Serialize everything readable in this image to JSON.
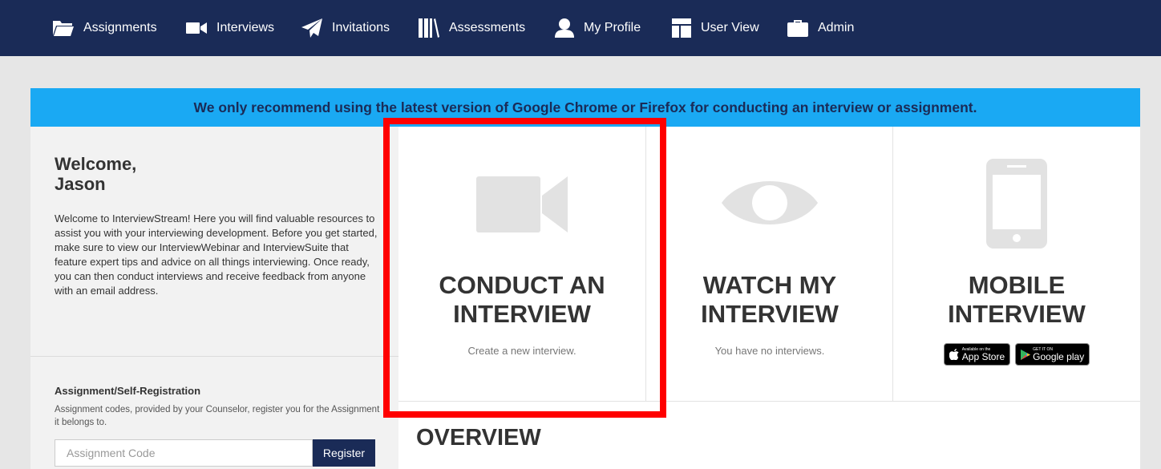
{
  "nav": {
    "assignments": "Assignments",
    "interviews": "Interviews",
    "invitations": "Invitations",
    "assessments": "Assessments",
    "profile": "My Profile",
    "userview": "User View",
    "admin": "Admin"
  },
  "banner": "We only recommend using the latest version of Google Chrome or Firefox for conducting an interview or assignment.",
  "welcome": {
    "line1": "Welcome,",
    "line2": "Jason",
    "text": "Welcome to InterviewStream! Here you will find valuable resources to assist you with your interviewing development. Before you get started, make sure to view our InterviewWebinar and InterviewSuite that feature expert tips and advice on all things interviewing. Once ready, you can then conduct interviews and receive feedback from anyone with an email address."
  },
  "assignment": {
    "title": "Assignment/Self-Registration",
    "text": "Assignment codes, provided by your Counselor, register you for the Assignment it belongs to.",
    "placeholder": "Assignment Code",
    "button": "Register"
  },
  "cards": {
    "conduct": {
      "line1": "CONDUCT AN",
      "line2": "INTERVIEW",
      "sub": "Create a new interview."
    },
    "watch": {
      "line1": "WATCH MY",
      "line2": "INTERVIEW",
      "sub": "You have no interviews."
    },
    "mobile": {
      "line1": "MOBILE",
      "line2": "INTERVIEW",
      "appstore_small": "Available on the",
      "appstore_big": "App Store",
      "google_small": "GET IT ON",
      "google_big": "Google play"
    }
  },
  "overview": "OVERVIEW",
  "colors": {
    "nav_bg": "#1a2b57",
    "banner_bg": "#1aa9f3",
    "highlight": "#ff0000",
    "icon_gray": "#e2e2e2"
  }
}
